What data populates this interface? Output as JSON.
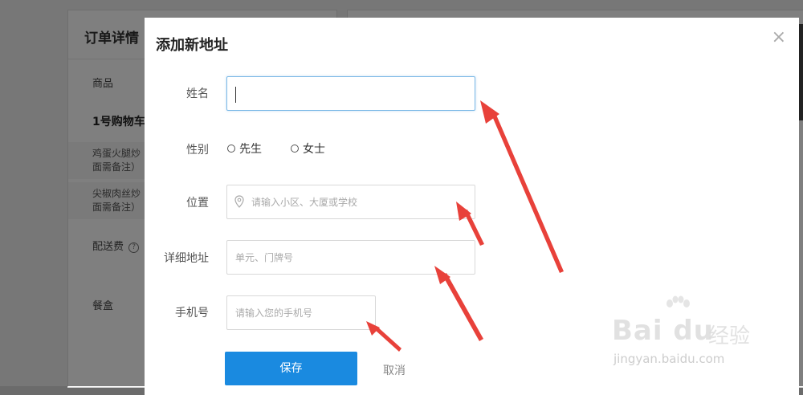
{
  "background": {
    "card_title": "订单详情",
    "goods_label": "商品",
    "cart_name": "1号购物车",
    "items": [
      {
        "line1": "鸡蛋火腿炒",
        "line2": "面需备注）"
      },
      {
        "line1": "尖椒肉丝炒",
        "line2": "面需备注）"
      }
    ],
    "delivery_fee_label": "配送费",
    "delivery_help_icon": "?",
    "box_label": "餐盒"
  },
  "modal": {
    "title": "添加新地址",
    "close_glyph": "×",
    "name": {
      "label": "姓名",
      "value": "",
      "placeholder": ""
    },
    "gender": {
      "label": "性别",
      "options": [
        {
          "label": "先生",
          "checked": false
        },
        {
          "label": "女士",
          "checked": false
        }
      ]
    },
    "location": {
      "label": "位置",
      "placeholder": "请输入小区、大厦或学校",
      "icon": "map-pin-icon"
    },
    "detail": {
      "label": "详细地址",
      "placeholder": "单元、门牌号"
    },
    "phone": {
      "label": "手机号",
      "placeholder": "请输入您的手机号"
    },
    "save_label": "保存",
    "cancel_label": "取消"
  },
  "watermark": {
    "brand": "Bai du",
    "brand_cn": "经验",
    "url": "jingyan.baidu.com"
  },
  "colors": {
    "primary": "#1a8ae0",
    "arrow": "#e8413a",
    "focus_border": "#7ab8e6"
  }
}
